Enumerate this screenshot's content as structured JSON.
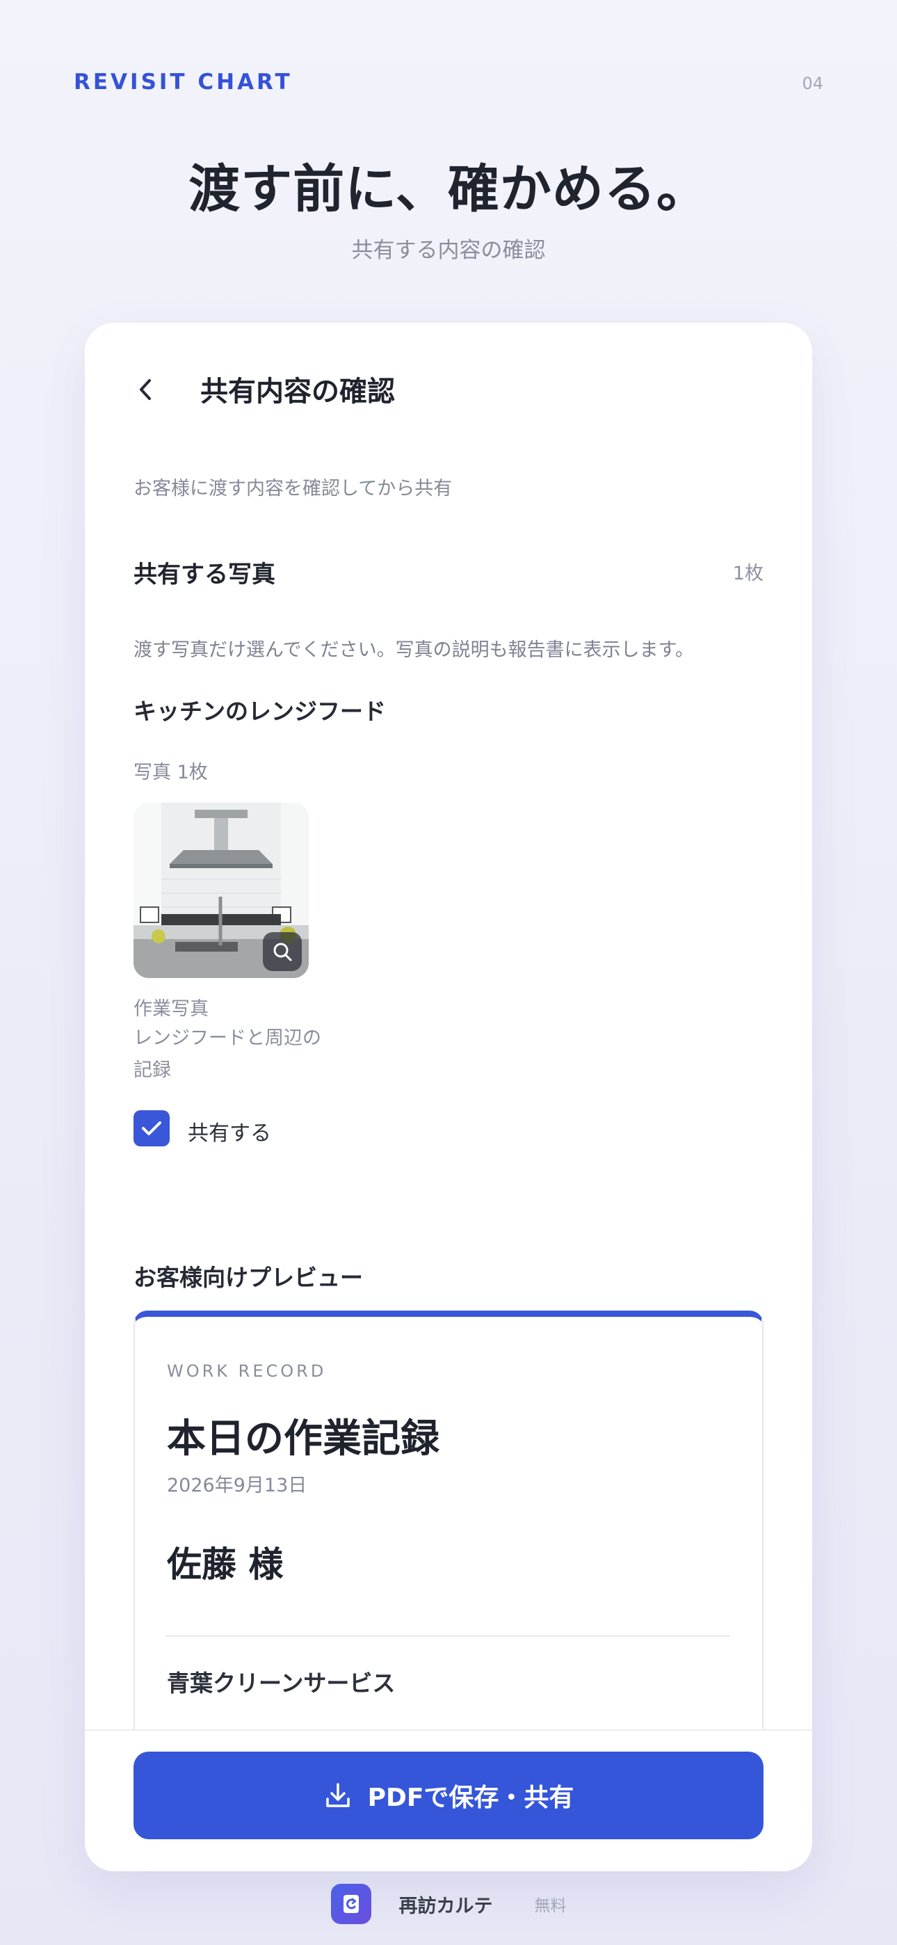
{
  "header": {
    "brand": "REVISIT CHART",
    "page_number": "04",
    "headline": "渡す前に、確かめる。",
    "subheadline": "共有する内容の確認"
  },
  "screen": {
    "back_icon": "chevron-left-icon",
    "title": "共有内容の確認",
    "intro": "お客様に渡す内容を確認してから共有",
    "photos_section": {
      "title": "共有する写真",
      "count": "1枚",
      "hint": "渡す写真だけ選んでください。写真の説明も報告書に表示します。"
    },
    "photo_group": {
      "title": "キッチンのレンジフード",
      "count": "写真 1枚",
      "photo": {
        "kind": "作業写真",
        "description": "レンジフードと周辺の記録",
        "zoom_icon": "magnifier-icon"
      },
      "share_label": "共有する",
      "share_checked": true
    },
    "preview": {
      "title": "お客様向けプレビュー",
      "eyebrow": "WORK RECORD",
      "record_title": "本日の作業記録",
      "date": "2026年9月13日",
      "customer": "佐藤 様",
      "company": "青葉クリーンサービス"
    },
    "primary_button": {
      "label": "PDFで保存・共有",
      "icon": "download-icon"
    }
  },
  "footer": {
    "app_icon": "refresh-document-icon",
    "app_name": "再訪カルテ",
    "price": "無料"
  },
  "colors": {
    "accent": "#3556d9",
    "background": "#efeff9",
    "text_primary": "#20242e",
    "text_muted": "#858a98"
  }
}
